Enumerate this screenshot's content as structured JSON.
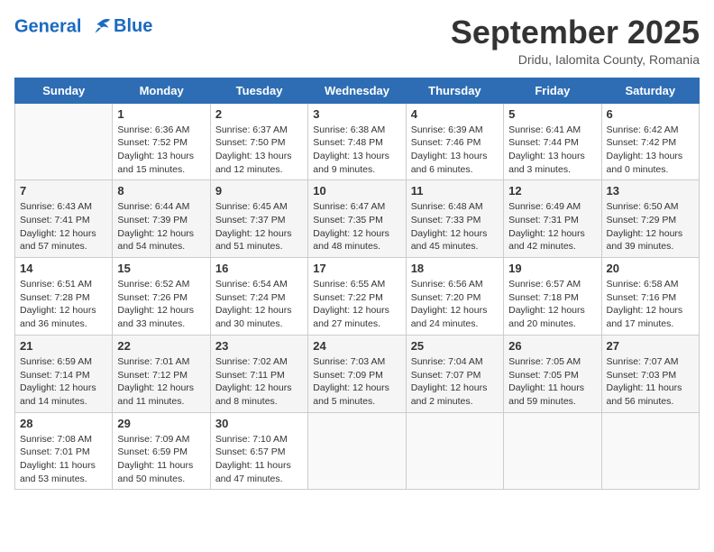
{
  "header": {
    "logo_line1": "General",
    "logo_line2": "Blue",
    "month": "September 2025",
    "location": "Dridu, Ialomita County, Romania"
  },
  "weekdays": [
    "Sunday",
    "Monday",
    "Tuesday",
    "Wednesday",
    "Thursday",
    "Friday",
    "Saturday"
  ],
  "weeks": [
    [
      {
        "day": "",
        "info": ""
      },
      {
        "day": "1",
        "info": "Sunrise: 6:36 AM\nSunset: 7:52 PM\nDaylight: 13 hours\nand 15 minutes."
      },
      {
        "day": "2",
        "info": "Sunrise: 6:37 AM\nSunset: 7:50 PM\nDaylight: 13 hours\nand 12 minutes."
      },
      {
        "day": "3",
        "info": "Sunrise: 6:38 AM\nSunset: 7:48 PM\nDaylight: 13 hours\nand 9 minutes."
      },
      {
        "day": "4",
        "info": "Sunrise: 6:39 AM\nSunset: 7:46 PM\nDaylight: 13 hours\nand 6 minutes."
      },
      {
        "day": "5",
        "info": "Sunrise: 6:41 AM\nSunset: 7:44 PM\nDaylight: 13 hours\nand 3 minutes."
      },
      {
        "day": "6",
        "info": "Sunrise: 6:42 AM\nSunset: 7:42 PM\nDaylight: 13 hours\nand 0 minutes."
      }
    ],
    [
      {
        "day": "7",
        "info": "Sunrise: 6:43 AM\nSunset: 7:41 PM\nDaylight: 12 hours\nand 57 minutes."
      },
      {
        "day": "8",
        "info": "Sunrise: 6:44 AM\nSunset: 7:39 PM\nDaylight: 12 hours\nand 54 minutes."
      },
      {
        "day": "9",
        "info": "Sunrise: 6:45 AM\nSunset: 7:37 PM\nDaylight: 12 hours\nand 51 minutes."
      },
      {
        "day": "10",
        "info": "Sunrise: 6:47 AM\nSunset: 7:35 PM\nDaylight: 12 hours\nand 48 minutes."
      },
      {
        "day": "11",
        "info": "Sunrise: 6:48 AM\nSunset: 7:33 PM\nDaylight: 12 hours\nand 45 minutes."
      },
      {
        "day": "12",
        "info": "Sunrise: 6:49 AM\nSunset: 7:31 PM\nDaylight: 12 hours\nand 42 minutes."
      },
      {
        "day": "13",
        "info": "Sunrise: 6:50 AM\nSunset: 7:29 PM\nDaylight: 12 hours\nand 39 minutes."
      }
    ],
    [
      {
        "day": "14",
        "info": "Sunrise: 6:51 AM\nSunset: 7:28 PM\nDaylight: 12 hours\nand 36 minutes."
      },
      {
        "day": "15",
        "info": "Sunrise: 6:52 AM\nSunset: 7:26 PM\nDaylight: 12 hours\nand 33 minutes."
      },
      {
        "day": "16",
        "info": "Sunrise: 6:54 AM\nSunset: 7:24 PM\nDaylight: 12 hours\nand 30 minutes."
      },
      {
        "day": "17",
        "info": "Sunrise: 6:55 AM\nSunset: 7:22 PM\nDaylight: 12 hours\nand 27 minutes."
      },
      {
        "day": "18",
        "info": "Sunrise: 6:56 AM\nSunset: 7:20 PM\nDaylight: 12 hours\nand 24 minutes."
      },
      {
        "day": "19",
        "info": "Sunrise: 6:57 AM\nSunset: 7:18 PM\nDaylight: 12 hours\nand 20 minutes."
      },
      {
        "day": "20",
        "info": "Sunrise: 6:58 AM\nSunset: 7:16 PM\nDaylight: 12 hours\nand 17 minutes."
      }
    ],
    [
      {
        "day": "21",
        "info": "Sunrise: 6:59 AM\nSunset: 7:14 PM\nDaylight: 12 hours\nand 14 minutes."
      },
      {
        "day": "22",
        "info": "Sunrise: 7:01 AM\nSunset: 7:12 PM\nDaylight: 12 hours\nand 11 minutes."
      },
      {
        "day": "23",
        "info": "Sunrise: 7:02 AM\nSunset: 7:11 PM\nDaylight: 12 hours\nand 8 minutes."
      },
      {
        "day": "24",
        "info": "Sunrise: 7:03 AM\nSunset: 7:09 PM\nDaylight: 12 hours\nand 5 minutes."
      },
      {
        "day": "25",
        "info": "Sunrise: 7:04 AM\nSunset: 7:07 PM\nDaylight: 12 hours\nand 2 minutes."
      },
      {
        "day": "26",
        "info": "Sunrise: 7:05 AM\nSunset: 7:05 PM\nDaylight: 11 hours\nand 59 minutes."
      },
      {
        "day": "27",
        "info": "Sunrise: 7:07 AM\nSunset: 7:03 PM\nDaylight: 11 hours\nand 56 minutes."
      }
    ],
    [
      {
        "day": "28",
        "info": "Sunrise: 7:08 AM\nSunset: 7:01 PM\nDaylight: 11 hours\nand 53 minutes."
      },
      {
        "day": "29",
        "info": "Sunrise: 7:09 AM\nSunset: 6:59 PM\nDaylight: 11 hours\nand 50 minutes."
      },
      {
        "day": "30",
        "info": "Sunrise: 7:10 AM\nSunset: 6:57 PM\nDaylight: 11 hours\nand 47 minutes."
      },
      {
        "day": "",
        "info": ""
      },
      {
        "day": "",
        "info": ""
      },
      {
        "day": "",
        "info": ""
      },
      {
        "day": "",
        "info": ""
      }
    ]
  ]
}
